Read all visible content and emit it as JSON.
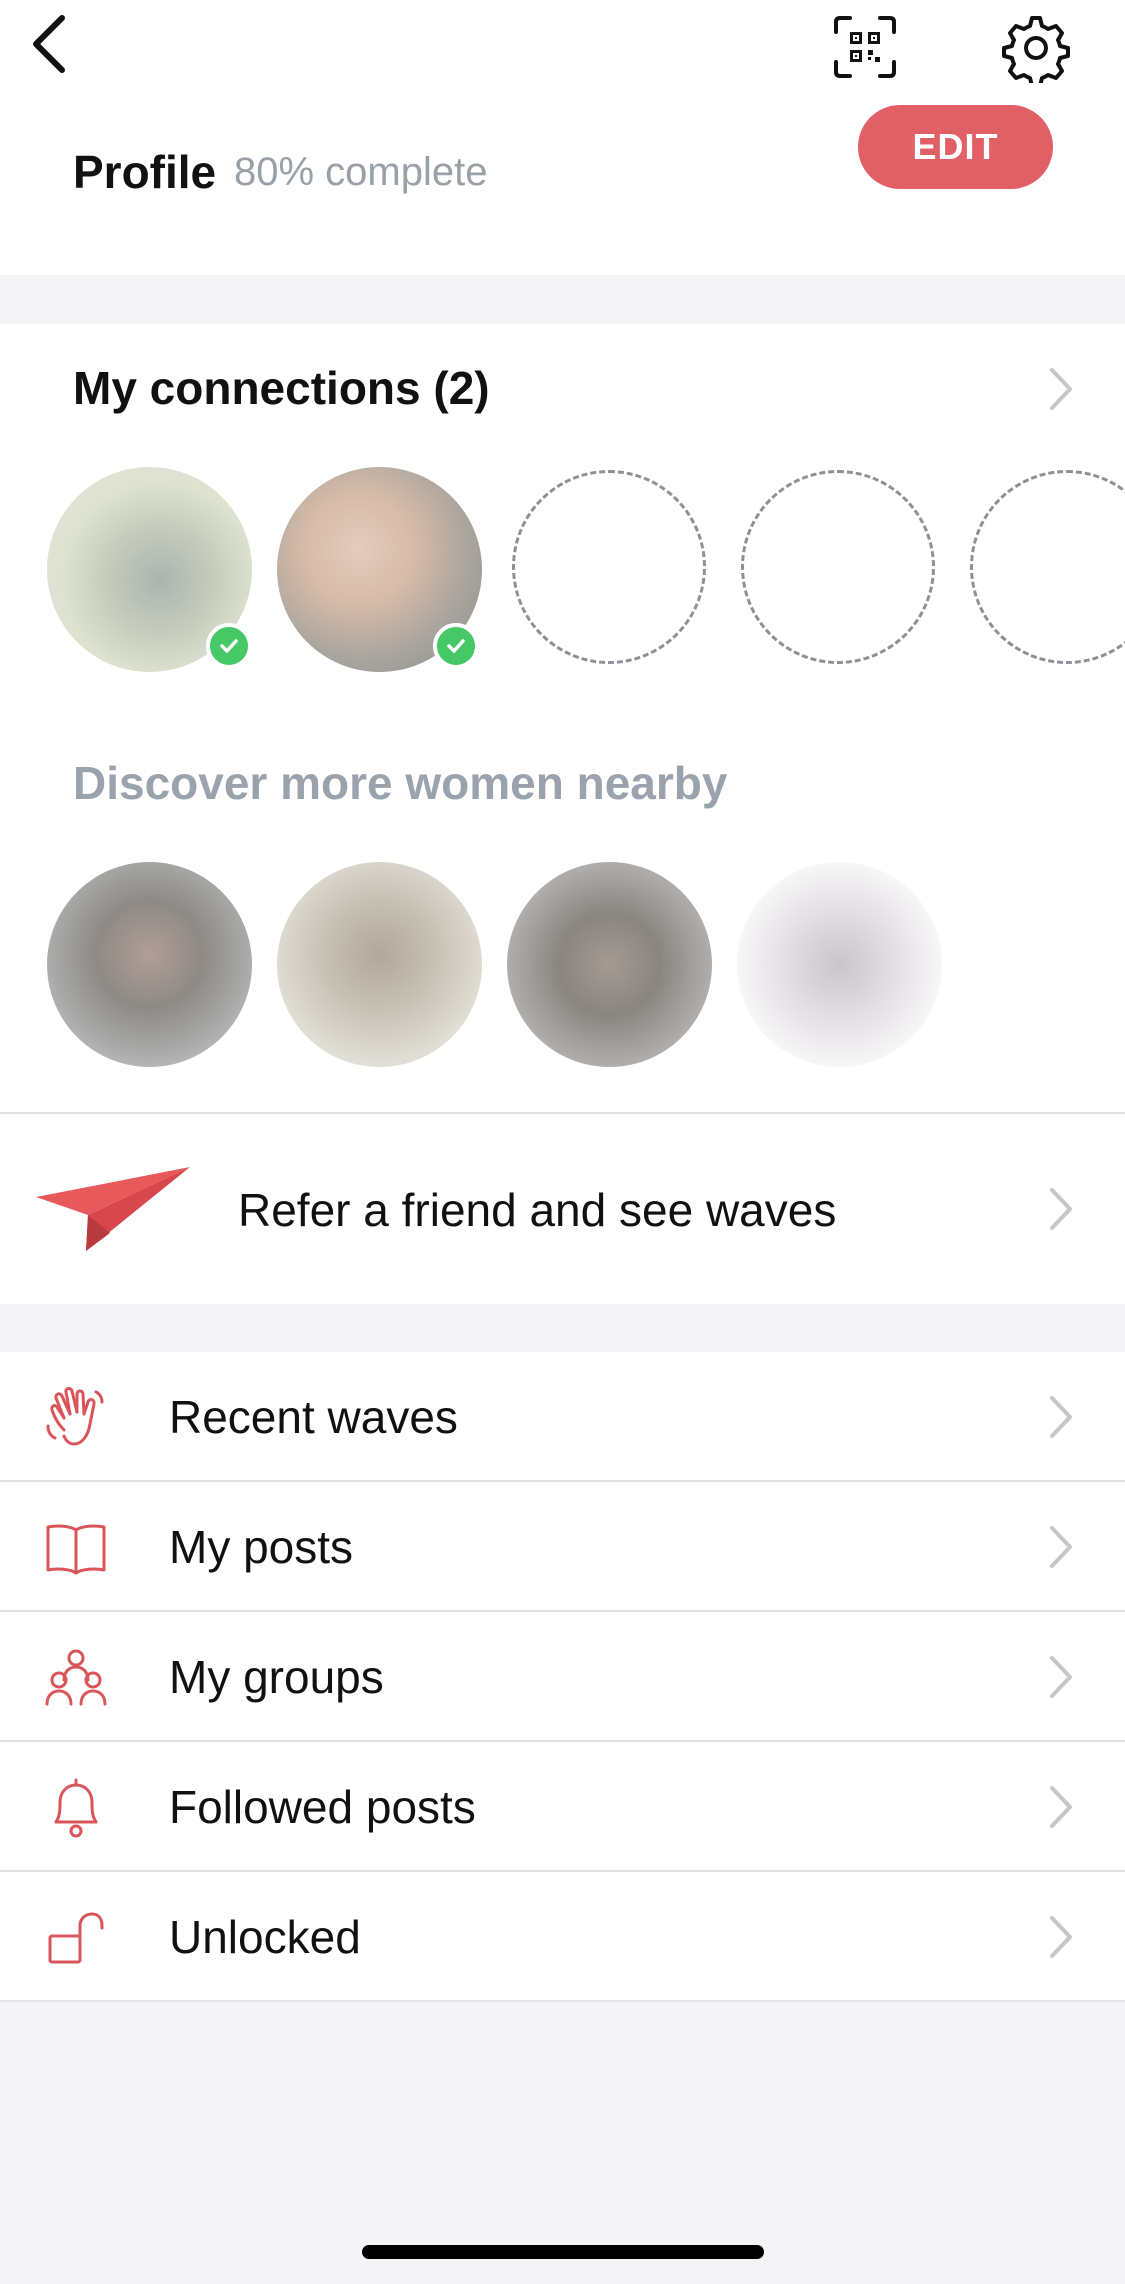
{
  "header": {
    "back_icon": "chevron-left-icon",
    "qr_icon": "qr-scan-icon",
    "settings_icon": "gear-icon"
  },
  "profile": {
    "title": "Profile",
    "progress": "80% complete",
    "progress_value": 80,
    "edit_label": "EDIT"
  },
  "connections": {
    "title": "My connections (2)",
    "count": 2,
    "verified_icon": "check-badge-icon",
    "empty_slots": 3
  },
  "discover": {
    "title": "Discover more women nearby",
    "profiles_shown": 4
  },
  "refer": {
    "label": "Refer a friend and see waves",
    "icon": "paper-plane-icon"
  },
  "menu": {
    "items": [
      {
        "label": "Recent waves",
        "icon": "wave-hand-icon"
      },
      {
        "label": "My posts",
        "icon": "book-icon"
      },
      {
        "label": "My groups",
        "icon": "group-icon"
      },
      {
        "label": "Followed posts",
        "icon": "bell-icon"
      },
      {
        "label": "Unlocked",
        "icon": "unlock-icon"
      }
    ]
  },
  "colors": {
    "accent": "#e06065",
    "verified": "#45c865",
    "muted_text": "#9aa0a8",
    "background": "#f4f4f6"
  }
}
